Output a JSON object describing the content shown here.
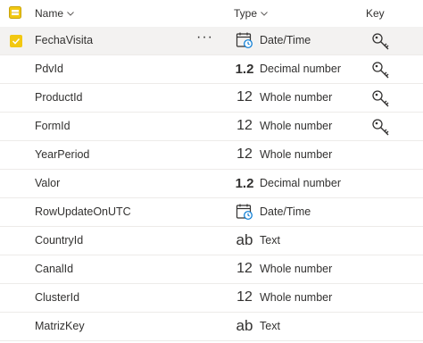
{
  "header": {
    "name_label": "Name",
    "type_label": "Type",
    "key_label": "Key"
  },
  "rows": [
    {
      "name": "FechaVisita",
      "type_icon": "calendar-icon",
      "type_glyph": "",
      "type": "Date/Time",
      "key": true,
      "selected": true,
      "more": "···"
    },
    {
      "name": "PdvId",
      "type_icon": "decimal-icon",
      "type_glyph": "1.2",
      "type": "Decimal number",
      "key": true,
      "selected": false
    },
    {
      "name": "ProductId",
      "type_icon": "whole-number-icon",
      "type_glyph": "12",
      "type": "Whole number",
      "key": true,
      "selected": false
    },
    {
      "name": "FormId",
      "type_icon": "whole-number-icon",
      "type_glyph": "12",
      "type": "Whole number",
      "key": true,
      "selected": false
    },
    {
      "name": "YearPeriod",
      "type_icon": "whole-number-icon",
      "type_glyph": "12",
      "type": "Whole number",
      "key": false,
      "selected": false
    },
    {
      "name": "Valor",
      "type_icon": "decimal-icon",
      "type_glyph": "1.2",
      "type": "Decimal number",
      "key": false,
      "selected": false
    },
    {
      "name": "RowUpdateOnUTC",
      "type_icon": "calendar-icon",
      "type_glyph": "",
      "type": "Date/Time",
      "key": false,
      "selected": false
    },
    {
      "name": "CountryId",
      "type_icon": "text-icon",
      "type_glyph": "ab",
      "type": "Text",
      "key": false,
      "selected": false
    },
    {
      "name": "CanalId",
      "type_icon": "whole-number-icon",
      "type_glyph": "12",
      "type": "Whole number",
      "key": false,
      "selected": false
    },
    {
      "name": "ClusterId",
      "type_icon": "whole-number-icon",
      "type_glyph": "12",
      "type": "Whole number",
      "key": false,
      "selected": false
    },
    {
      "name": "MatrizKey",
      "type_icon": "text-icon",
      "type_glyph": "ab",
      "type": "Text",
      "key": false,
      "selected": false
    }
  ],
  "colors": {
    "accent": "#f2c811",
    "selected_row": "#f3f2f1",
    "divider": "#edebe9",
    "text": "#323130"
  }
}
